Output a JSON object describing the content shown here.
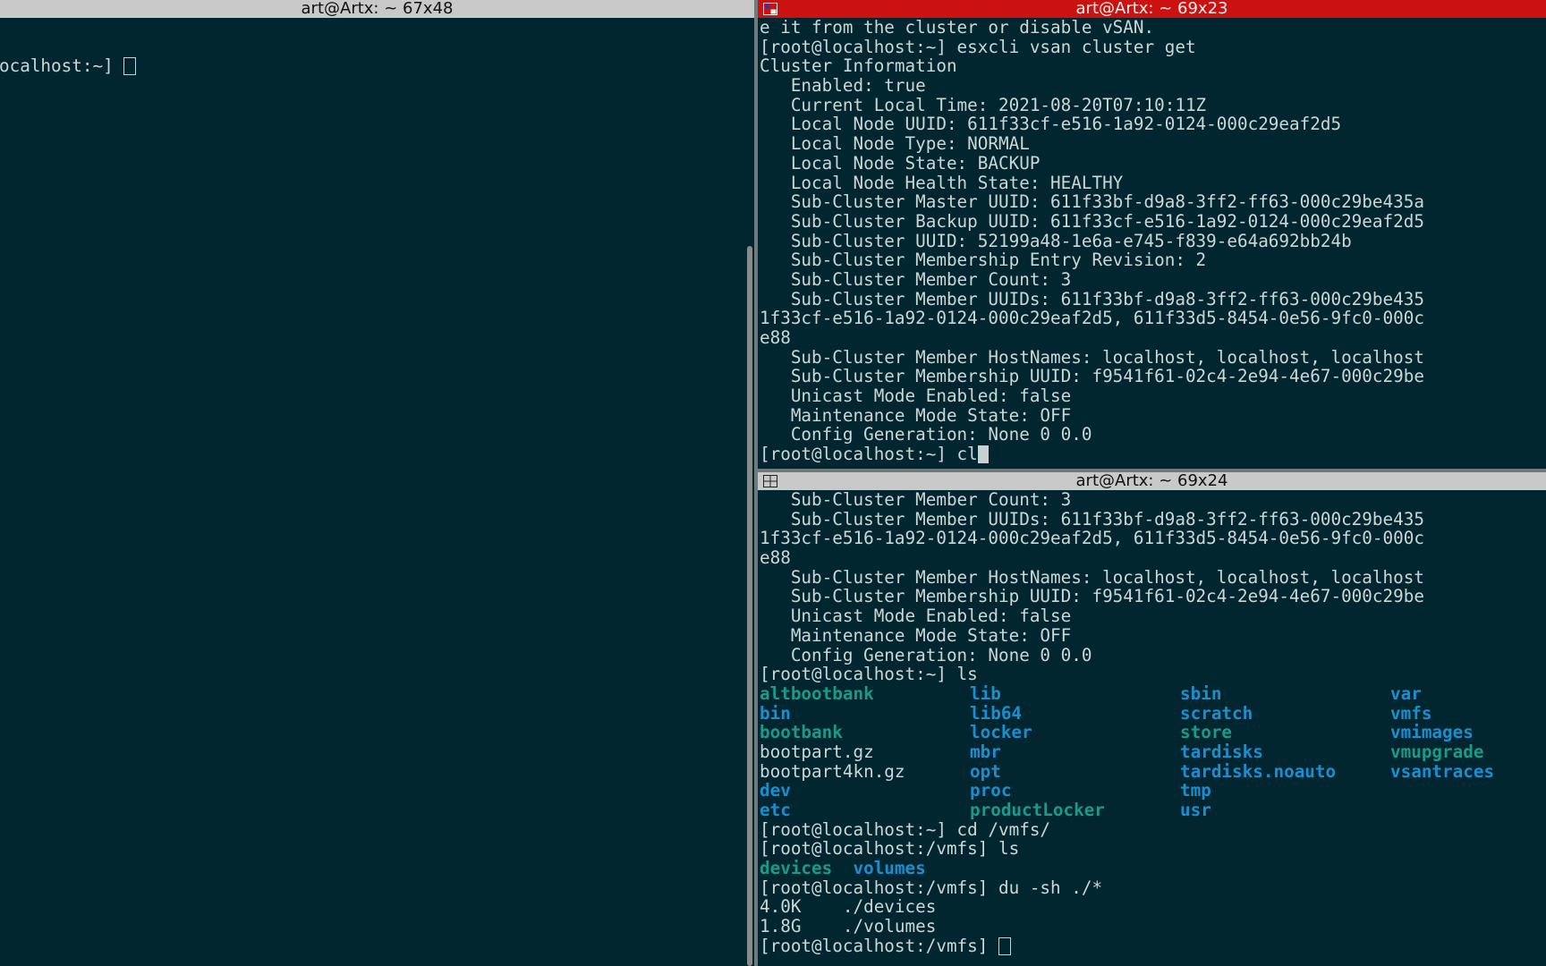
{
  "left_pane": {
    "title": "art@Artx: ~ 67x48",
    "prompt": "ocalhost:~] "
  },
  "top_right_pane": {
    "title": "art@Artx: ~ 69x23",
    "lines": [
      "e it from the cluster or disable vSAN.",
      "[root@localhost:~] esxcli vsan cluster get",
      "Cluster Information",
      "   Enabled: true",
      "   Current Local Time: 2021-08-20T07:10:11Z",
      "   Local Node UUID: 611f33cf-e516-1a92-0124-000c29eaf2d5",
      "   Local Node Type: NORMAL",
      "   Local Node State: BACKUP",
      "   Local Node Health State: HEALTHY",
      "   Sub-Cluster Master UUID: 611f33bf-d9a8-3ff2-ff63-000c29be435a",
      "   Sub-Cluster Backup UUID: 611f33cf-e516-1a92-0124-000c29eaf2d5",
      "   Sub-Cluster UUID: 52199a48-1e6a-e745-f839-e64a692bb24b",
      "   Sub-Cluster Membership Entry Revision: 2",
      "   Sub-Cluster Member Count: 3",
      "   Sub-Cluster Member UUIDs: 611f33bf-d9a8-3ff2-ff63-000c29be435",
      "1f33cf-e516-1a92-0124-000c29eaf2d5, 611f33d5-8454-0e56-9fc0-000c",
      "e88",
      "   Sub-Cluster Member HostNames: localhost, localhost, localhost",
      "   Sub-Cluster Membership UUID: f9541f61-02c4-2e94-4e67-000c29be",
      "   Unicast Mode Enabled: false",
      "   Maintenance Mode State: OFF",
      "   Config Generation: None 0 0.0"
    ],
    "prompt": "[root@localhost:~] cl"
  },
  "bottom_right_pane": {
    "title": "art@Artx: ~ 69x24",
    "lines_before_ls": [
      "   Sub-Cluster Member Count: 3",
      "   Sub-Cluster Member UUIDs: 611f33bf-d9a8-3ff2-ff63-000c29be435",
      "1f33cf-e516-1a92-0124-000c29eaf2d5, 611f33d5-8454-0e56-9fc0-000c",
      "e88",
      "   Sub-Cluster Member HostNames: localhost, localhost, localhost",
      "   Sub-Cluster Membership UUID: f9541f61-02c4-2e94-4e67-000c29be",
      "   Unicast Mode Enabled: false",
      "   Maintenance Mode State: OFF",
      "   Config Generation: None 0 0.0",
      "[root@localhost:~] ls"
    ],
    "ls_rows": [
      [
        {
          "t": "altbootbank",
          "c": "exe"
        },
        {
          "t": "lib",
          "c": "dir"
        },
        {
          "t": "sbin",
          "c": "dir"
        },
        {
          "t": "var",
          "c": "dir"
        }
      ],
      [
        {
          "t": "bin",
          "c": "dir"
        },
        {
          "t": "lib64",
          "c": "dir"
        },
        {
          "t": "scratch",
          "c": "dir"
        },
        {
          "t": "vmfs",
          "c": "dir"
        }
      ],
      [
        {
          "t": "bootbank",
          "c": "exe"
        },
        {
          "t": "locker",
          "c": "dir"
        },
        {
          "t": "store",
          "c": "exe"
        },
        {
          "t": "vmimages",
          "c": "dir"
        }
      ],
      [
        {
          "t": "bootpart.gz",
          "c": "norm"
        },
        {
          "t": "mbr",
          "c": "dir"
        },
        {
          "t": "tardisks",
          "c": "dir"
        },
        {
          "t": "vmupgrade",
          "c": "exe"
        }
      ],
      [
        {
          "t": "bootpart4kn.gz",
          "c": "norm"
        },
        {
          "t": "opt",
          "c": "dir"
        },
        {
          "t": "tardisks.noauto",
          "c": "dir"
        },
        {
          "t": "vsantraces",
          "c": "dir"
        }
      ],
      [
        {
          "t": "dev",
          "c": "dir"
        },
        {
          "t": "proc",
          "c": "dir"
        },
        {
          "t": "tmp",
          "c": "dir"
        },
        {
          "t": "",
          "c": "norm"
        }
      ],
      [
        {
          "t": "etc",
          "c": "dir"
        },
        {
          "t": "productLocker",
          "c": "exe"
        },
        {
          "t": "usr",
          "c": "dir"
        },
        {
          "t": "",
          "c": "norm"
        }
      ]
    ],
    "lines_after_ls": [
      "[root@localhost:~] cd /vmfs/",
      "[root@localhost:/vmfs] ls"
    ],
    "vmfs_ls": [
      {
        "t": "devices",
        "c": "exe"
      },
      {
        "t": "volumes",
        "c": "dir"
      }
    ],
    "lines_final": [
      "[root@localhost:/vmfs] du -sh ./*",
      "4.0K    ./devices",
      "1.8G    ./volumes"
    ],
    "prompt": "[root@localhost:/vmfs] "
  }
}
